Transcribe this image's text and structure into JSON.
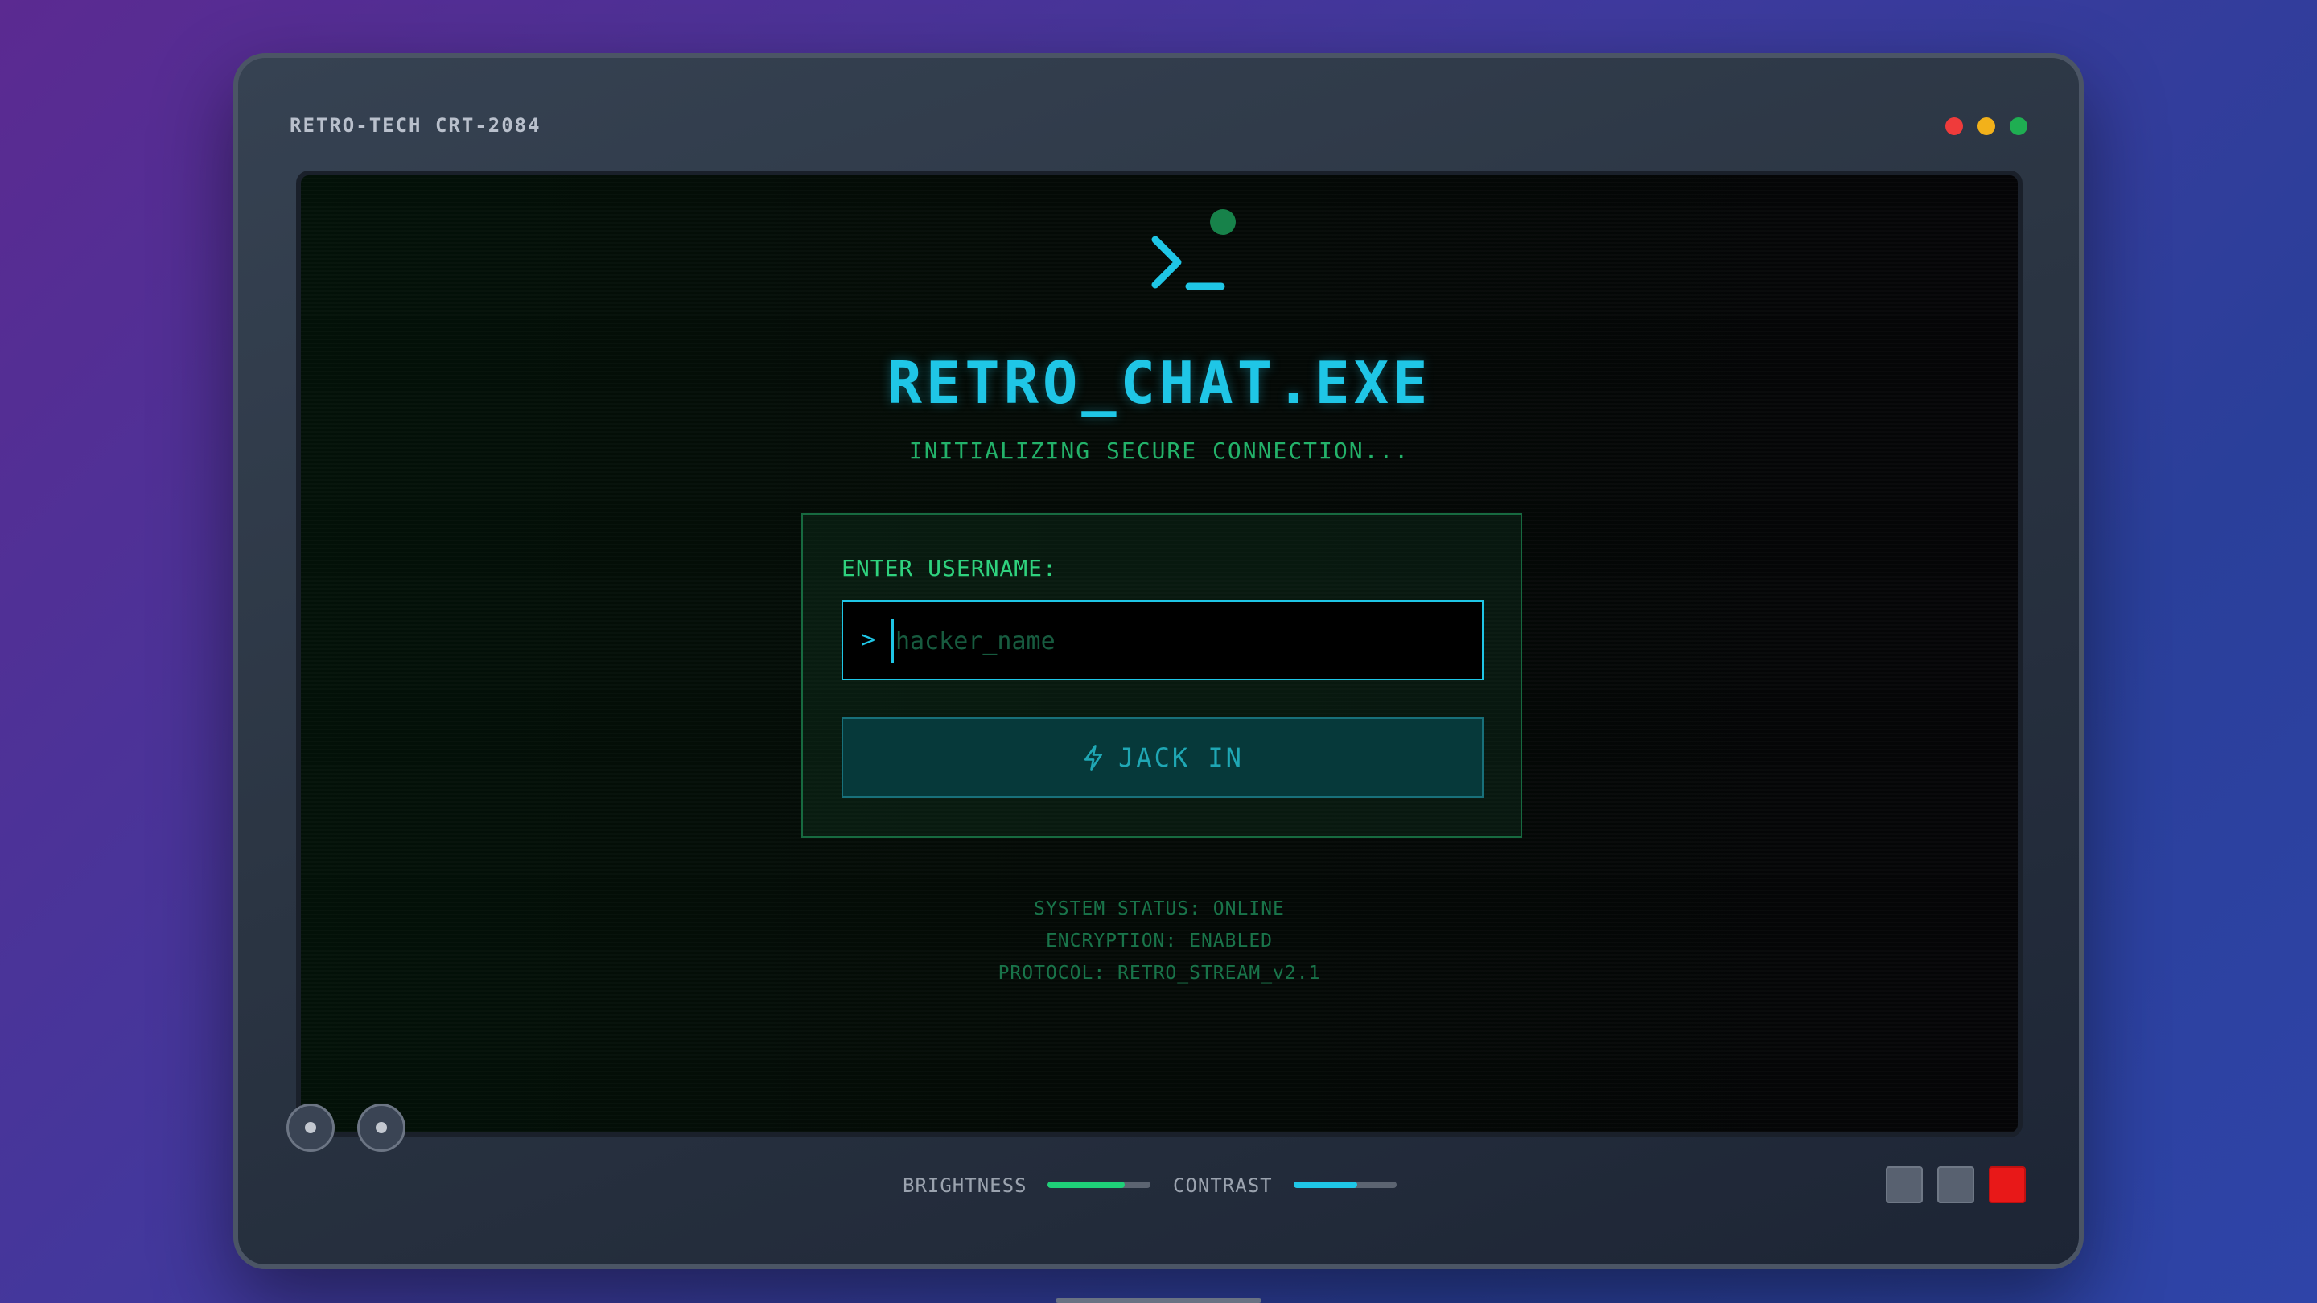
{
  "monitor": {
    "brand": "RETRO-TECH CRT-2084",
    "window_dots": [
      {
        "name": "close",
        "color": "#ef3b3b"
      },
      {
        "name": "minimize",
        "color": "#f2b11a"
      },
      {
        "name": "maximize",
        "color": "#1fae52"
      }
    ]
  },
  "app": {
    "icon": "terminal-icon",
    "title": "RETRO_CHAT.EXE",
    "subtitle": "INITIALIZING SECURE CONNECTION..."
  },
  "login": {
    "label": "ENTER USERNAME:",
    "prompt": ">",
    "username_value": "",
    "username_placeholder": "hacker_name",
    "button_icon": "lightning-icon",
    "button_label": "JACK IN"
  },
  "status_lines": [
    "SYSTEM STATUS: ONLINE",
    "ENCRYPTION: ENABLED",
    "PROTOCOL: RETRO_STREAM_v2.1"
  ],
  "controls": {
    "brightness_label": "BRIGHTNESS",
    "brightness_level": 0.75,
    "brightness_color": "#1fd078",
    "contrast_label": "CONTRAST",
    "contrast_level": 0.62,
    "contrast_color": "#1fc6e6",
    "power_button_color": "#e81818"
  },
  "colors": {
    "accent_cyan": "#1fc6e6",
    "accent_green": "#2fd27e"
  }
}
